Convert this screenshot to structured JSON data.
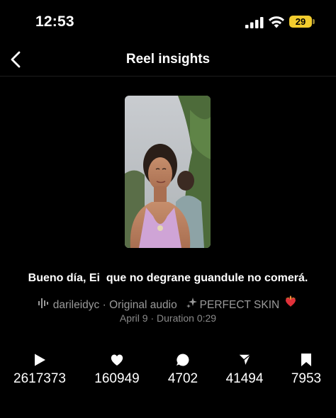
{
  "status_bar": {
    "time": "12:53",
    "battery_level": "29",
    "icons": [
      "cellular-signal-icon",
      "wifi-icon",
      "battery-icon"
    ]
  },
  "header": {
    "title": "Reel insights",
    "back_icon": "chevron-left-icon"
  },
  "reel": {
    "caption": "Bueno día, Ei  que no degrane guandule no comerá.",
    "author": "darileidyc",
    "separator": "·",
    "audio": "Original audio",
    "effect": "PERFECT SKIN",
    "date": "April 9",
    "duration_label": "Duration 0:29"
  },
  "stats": [
    {
      "icon": "play-icon",
      "value": "2617373"
    },
    {
      "icon": "heart-icon",
      "value": "160949"
    },
    {
      "icon": "comment-icon",
      "value": "4702"
    },
    {
      "icon": "share-icon",
      "value": "41494"
    },
    {
      "icon": "save-icon",
      "value": "7953"
    }
  ],
  "colors": {
    "background": "#000000",
    "text_primary": "#ffffff",
    "text_secondary": "#9a9a9a",
    "battery": "#f2cc2e"
  }
}
